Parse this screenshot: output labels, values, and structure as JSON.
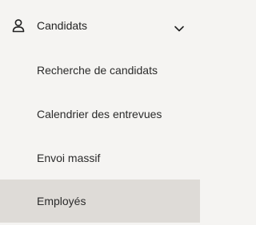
{
  "section": {
    "label": "Candidats",
    "icon": "person-icon",
    "toggle_icon": "chevron-down-icon",
    "expanded": true
  },
  "items": [
    {
      "label": "Recherche de candidats",
      "active": false
    },
    {
      "label": "Calendrier des entrevues",
      "active": false
    },
    {
      "label": "Envoi massif",
      "active": false
    },
    {
      "label": "Employés",
      "active": true
    }
  ],
  "colors": {
    "background": "#f5f4f2",
    "active_background": "#dedbd7",
    "text": "#2b2b2b"
  }
}
